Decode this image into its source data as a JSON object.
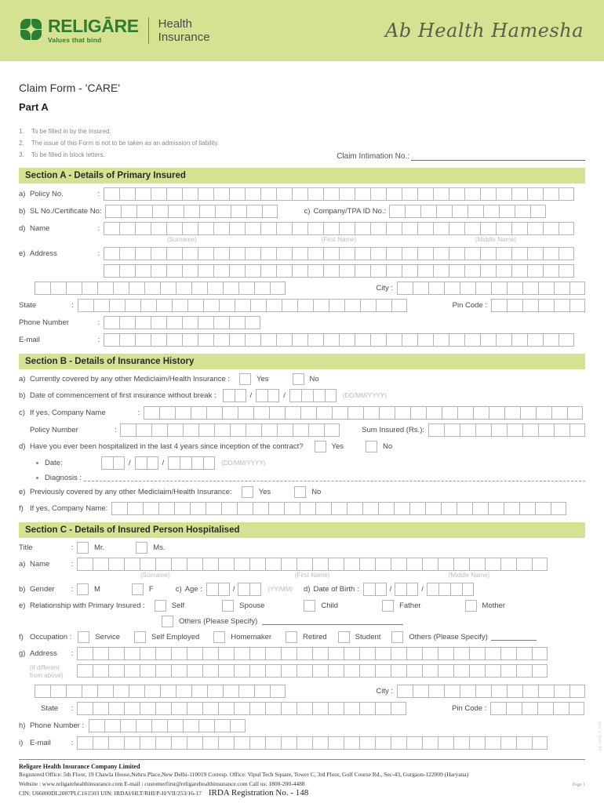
{
  "header": {
    "brand_name": "RELIGĀRE",
    "brand_tagline": "Values that bind",
    "product_line1": "Health",
    "product_line2": "Insurance",
    "slogan": "Ab Health Hamesha",
    "bg_color": "#d5e292",
    "brand_color": "#2e7d32"
  },
  "form": {
    "title": "Claim Form - 'CARE'",
    "part": "Part A",
    "notes": [
      {
        "num": "1.",
        "text": "To be filled in by the Insured."
      },
      {
        "num": "2.",
        "text": "The issue of this Form is not to be taken as an admission of liability."
      },
      {
        "num": "3.",
        "text": "To be filled in block letters."
      }
    ],
    "intimation_label": "Claim Intimation No.:"
  },
  "section_a": {
    "heading": "Section A - Details of Primary Insured",
    "policy_no": {
      "index": "a)",
      "label": "Policy No.",
      "colon": ":",
      "boxes": 30
    },
    "sl_no": {
      "index": "b)",
      "label": "SL No./Certificate No:",
      "boxes": 11
    },
    "company_tpa": {
      "index": "c)",
      "label": "Company/TPA ID No.:",
      "boxes": 10
    },
    "name": {
      "index": "d)",
      "label": "Name",
      "colon": ":",
      "boxes": 30
    },
    "name_parts": [
      "(Surname)",
      "(First Name)",
      "(Middle Name)"
    ],
    "address": {
      "index": "e)",
      "label": "Address",
      "colon": ":",
      "boxes": 30
    },
    "address_line2_boxes": 30,
    "address_line3_boxes": 16,
    "city": {
      "label": "City :",
      "boxes": 12
    },
    "state": {
      "label": "State",
      "colon": ":",
      "boxes": 21
    },
    "pin_code": {
      "label": "Pin Code :",
      "boxes": 6
    },
    "phone": {
      "label": "Phone Number",
      "colon": ":",
      "boxes": 10
    },
    "email": {
      "label": "E-mail",
      "colon": ":",
      "boxes": 30
    }
  },
  "section_b": {
    "heading": "Section B - Details of Insurance History",
    "a": {
      "index": "a)",
      "label": "Currently covered by any other Mediclaim/Health Insurance :",
      "yes": "Yes",
      "no": "No"
    },
    "b": {
      "index": "b)",
      "label": "Date of commencement of first insurance without break :",
      "dd": 2,
      "mm": 2,
      "yyyy": 4,
      "hint": "(DD/MM/YYYY)"
    },
    "c": {
      "index": "c)",
      "label": "If yes, Company Name",
      "colon": ":",
      "boxes": 28
    },
    "policy_number": {
      "label": "Policy Number",
      "colon": ":",
      "boxes": 14
    },
    "sum_insured": {
      "label": "Sum Insured (Rs.):",
      "boxes": 10
    },
    "d": {
      "index": "d)",
      "label": "Have you ever been hospitalized in the last 4 years since inception of the contract?",
      "yes": "Yes",
      "no": "No"
    },
    "d_date": {
      "label": "Date:",
      "dd": 2,
      "mm": 2,
      "yyyy": 4,
      "hint": "(DD/MM/YYYY)"
    },
    "d_diagnosis": {
      "label": "Diagnosis :"
    },
    "e": {
      "index": "e)",
      "label": "Previously covered by any other Mediclaim/Health Insurance:",
      "yes": "Yes",
      "no": "No"
    },
    "f": {
      "index": "f)",
      "label": "If yes, Company Name:",
      "boxes": 29
    }
  },
  "section_c": {
    "heading": "Section C - Details of Insured Person Hospitalised",
    "title": {
      "label": "Title",
      "colon": ":",
      "mr": "Mr.",
      "ms": "Ms."
    },
    "a": {
      "index": "a)",
      "label": "Name",
      "colon": ":",
      "boxes": 30
    },
    "name_parts": [
      "(Surname)",
      "(First Name)",
      "(Middle Name)"
    ],
    "gender": {
      "index": "b)",
      "label": "Gender",
      "colon": ":",
      "m": "M",
      "f": "F"
    },
    "age": {
      "index": "c)",
      "label": "Age :",
      "yy": 2,
      "mm": 2,
      "hint": "(YY/MM)"
    },
    "dob": {
      "index": "d)",
      "label": "Date of Birth :",
      "dd": 2,
      "mm": 2,
      "yyyy": 4
    },
    "relationship": {
      "index": "e)",
      "label": "Relationship with Primary Insured :",
      "options": [
        "Self",
        "Spouse",
        "Child",
        "Father",
        "Mother"
      ],
      "others": "Others (Please Specify)"
    },
    "occupation": {
      "index": "f)",
      "label": "Occupation :",
      "options": [
        "Service",
        "Self Employed",
        "Homemaker",
        "Retired",
        "Student"
      ],
      "others": "Others (Please Specify)"
    },
    "address": {
      "index": "g)",
      "label": "Address",
      "colon": ":",
      "sub1": "(if different",
      "sub2": "from above)",
      "boxes": 30
    },
    "address_line2_boxes": 30,
    "address_line3_boxes": 16,
    "city": {
      "label": "City :",
      "boxes": 12
    },
    "state": {
      "label": "State",
      "colon": ":",
      "boxes": 21
    },
    "pin_code": {
      "label": "Pin Code :",
      "boxes": 6
    },
    "phone": {
      "index": "h)",
      "label": "Phone Number :",
      "boxes": 10
    },
    "email": {
      "index": "i)",
      "label": "E-mail",
      "colon": ":",
      "boxes": 30
    }
  },
  "footer": {
    "company": "Religare Health Insurance Company Limited",
    "line1": "Registered Office: 5th Floor, 19 Chawla House,Nehru Place,New Delhi-110019    Corresp. Office: Vipul Tech Square, Tower C, 3rd Floor, Golf Course Rd., Sec-43, Gurgaon-122009 (Haryana)",
    "line2": "Website : www.religarehealthinsurance.com    E-mail : customerfirst@religarehealthinsurance.com    Call us: 1800-200-4488",
    "cin": "CIN: U66000DL2007PLC161503    UIN: IRDAI/HLT/RHI/P-H/VII/253/16-17",
    "irda": "IRDA Registration No. - 148",
    "page": "Page 1",
    "sidecode": "Ver 1 Nov-16"
  }
}
